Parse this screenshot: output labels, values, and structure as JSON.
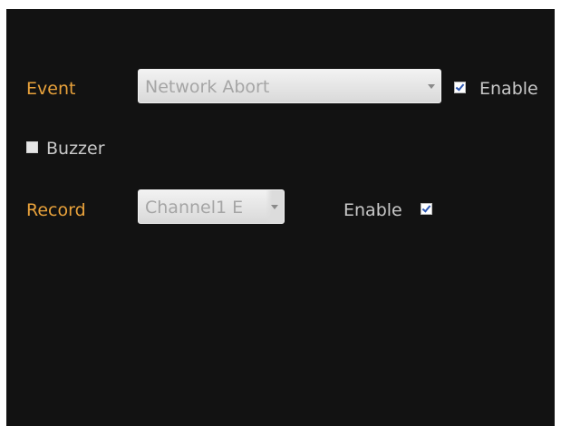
{
  "event_row": {
    "label": "Event",
    "select_value": "Network Abort",
    "enable_label": "Enable",
    "enable_checked": true
  },
  "buzzer": {
    "label": "Buzzer",
    "checked": false
  },
  "record_row": {
    "label": "Record",
    "select_value": "Channel1 E",
    "enable_label": "Enable",
    "enable_checked": true
  },
  "colors": {
    "background": "#121212",
    "label_accent": "#e9a23b",
    "text": "#c9c9c9",
    "checkbox_check": "#2c57b3"
  }
}
